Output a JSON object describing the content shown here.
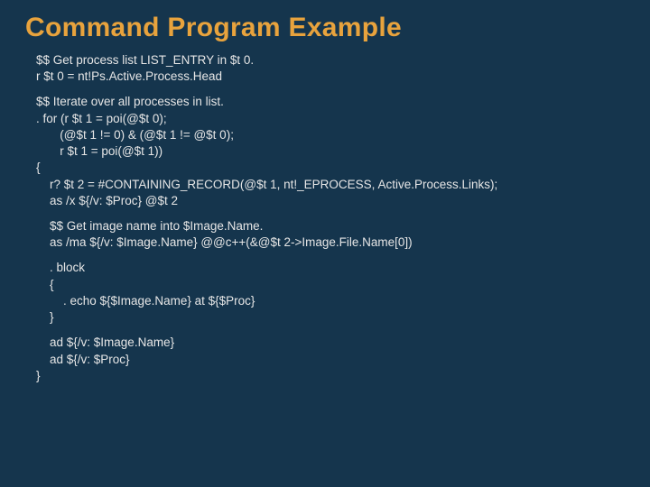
{
  "title": "Command Program Example",
  "blocks": [
    "$$ Get process list LIST_ENTRY in $t 0.\nr $t 0 = nt!Ps.Active.Process.Head",
    "$$ Iterate over all processes in list.\n. for (r $t 1 = poi(@$t 0);\n       (@$t 1 != 0) & (@$t 1 != @$t 0);\n       r $t 1 = poi(@$t 1))\n{\n    r? $t 2 = #CONTAINING_RECORD(@$t 1, nt!_EPROCESS, Active.Process.Links);\n    as /x ${/v: $Proc} @$t 2",
    "    $$ Get image name into $Image.Name.\n    as /ma ${/v: $Image.Name} @@c++(&@$t 2->Image.File.Name[0])",
    "    . block\n    {\n        . echo ${$Image.Name} at ${$Proc}\n    }",
    "    ad ${/v: $Image.Name}\n    ad ${/v: $Proc}\n}"
  ]
}
